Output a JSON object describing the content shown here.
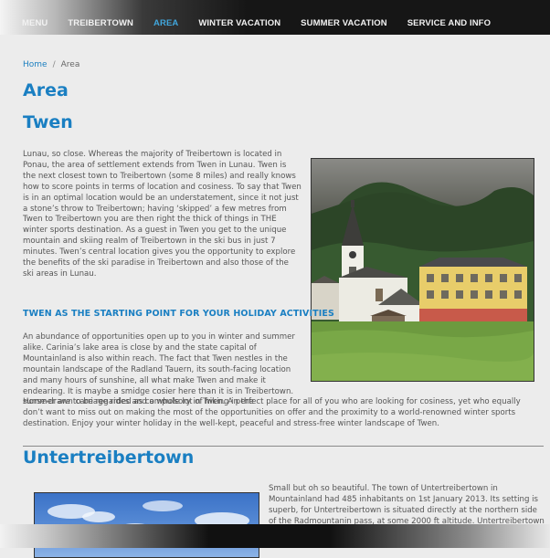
{
  "nav": {
    "items": [
      {
        "label": "MENU"
      },
      {
        "label": "TREIBERTOWN"
      },
      {
        "label": "AREA"
      },
      {
        "label": "WINTER VACATION"
      },
      {
        "label": "SUMMER VACATION"
      },
      {
        "label": "SERVICE AND INFO"
      }
    ]
  },
  "breadcrumb": {
    "home": "Home",
    "separator": "/",
    "current": "Area"
  },
  "page": {
    "title": "Area",
    "section1": {
      "title": "Twen",
      "paragraph": "Lunau, so close. Whereas the majority of Treibertown is located in Ponau, the area of settlement extends from Twen in Lunau. Twen is the next closest town to Treibertown (some 8 miles) and really knows how to score points in terms of location and cosiness. To say that Twen is in an optimal location would be an understatement, since it not just a stone’s throw to Treibertown; having ‘skipped’ a few metres from Twen to Treibertown you are then right the thick of things in THE winter sports destination. As a guest in Twen you get to the unique mountain and skiing realm of Treibertown in the ski bus in just 7 minutes. Twen’s central location gives you the opportunity to explore the benefits of the ski paradise in Treibertown and also those of the ski areas in Lunau."
    },
    "section2": {
      "title": "TWEN AS THE STARTING POINT FOR YOUR HOLIDAY ACTIVITIES",
      "paragraph_a": "An abundance of opportunities open up to you in winter and summer alike. Carinia’s lake area is close by and the state capital of Mountainland is also within reach. The fact that Twen nestles in the mountain landscape of the Radland Tauern, its south-facing location and many hours of sunshine, all what make Twen and make it endearing. It is maybe a smidge cosier here than it is in Treibertown. Horse-drawn carriage rides and a whole lot of hiking in the",
      "paragraph_b": "summer are to be regarded as compulsory in Twen. A perfect place for all of you who are looking for cosiness, yet who equally don’t want to miss out on making the most of the opportunities on offer and the proximity to a world-renowned winter sports destination. Enjoy your winter holiday in the well-kept, peaceful and stress-free winter landscape of Twen."
    },
    "section3": {
      "title": "Untertreibertown",
      "paragraph": "Small but oh so beautiful. The town of Untertreibertown in Mountainland had 485 inhabitants on 1st January 2013. Its setting is superb, for Untertreibertown is situated directly at the northern side of the Radmountanin pass, at some 2000 ft altitude. Untertreibertown is itself an original settlement. Even at the"
    }
  },
  "images": {
    "photo1": "church-village-photo",
    "photo2": "sky-photo"
  },
  "colors": {
    "accent": "#1a7fc2",
    "nav_active": "#41a6dc",
    "nav_bg": "#161616",
    "page_bg": "#ececec",
    "body_text": "#555555"
  }
}
